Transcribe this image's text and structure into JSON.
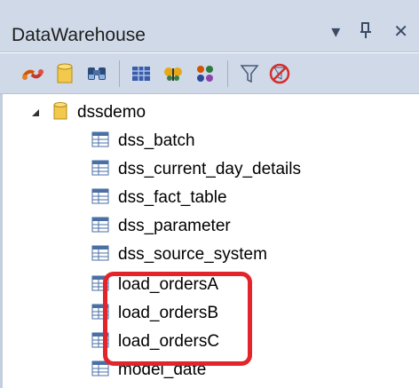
{
  "panel": {
    "title": "DataWarehouse",
    "title_buttons": [
      {
        "icon": "dropdown-arrow-icon",
        "glyph": "▾"
      },
      {
        "icon": "pin-icon",
        "glyph": "ᛟ"
      },
      {
        "icon": "close-icon",
        "glyph": "✕"
      }
    ]
  },
  "toolbar": {
    "buttons": [
      {
        "icon": "connect-icon"
      },
      {
        "icon": "database-icon"
      },
      {
        "icon": "binoculars-icon"
      },
      {
        "icon": "table-grid-icon"
      },
      {
        "icon": "butterfly-icon"
      },
      {
        "icon": "settings-cubes-icon"
      },
      {
        "icon": "filter-icon"
      },
      {
        "icon": "no-filter-icon"
      }
    ]
  },
  "tree": {
    "root": {
      "label": "dssdemo",
      "expanded": true,
      "icon": "database-icon"
    },
    "items": [
      {
        "label": "dss_batch",
        "icon": "table-icon"
      },
      {
        "label": "dss_current_day_details",
        "icon": "table-icon"
      },
      {
        "label": "dss_fact_table",
        "icon": "table-icon"
      },
      {
        "label": "dss_parameter",
        "icon": "table-icon"
      },
      {
        "label": "dss_source_system",
        "icon": "table-icon"
      },
      {
        "label": "load_ordersA",
        "icon": "table-icon"
      },
      {
        "label": "load_ordersB",
        "icon": "table-icon"
      },
      {
        "label": "load_ordersC",
        "icon": "table-icon"
      },
      {
        "label": "model_date",
        "icon": "table-icon"
      }
    ]
  },
  "colors": {
    "header_bg": "#cfd9e8",
    "highlight": "#e3242b",
    "database_yellow": "#f2c94c",
    "table_icon": "#4a6fa5"
  }
}
